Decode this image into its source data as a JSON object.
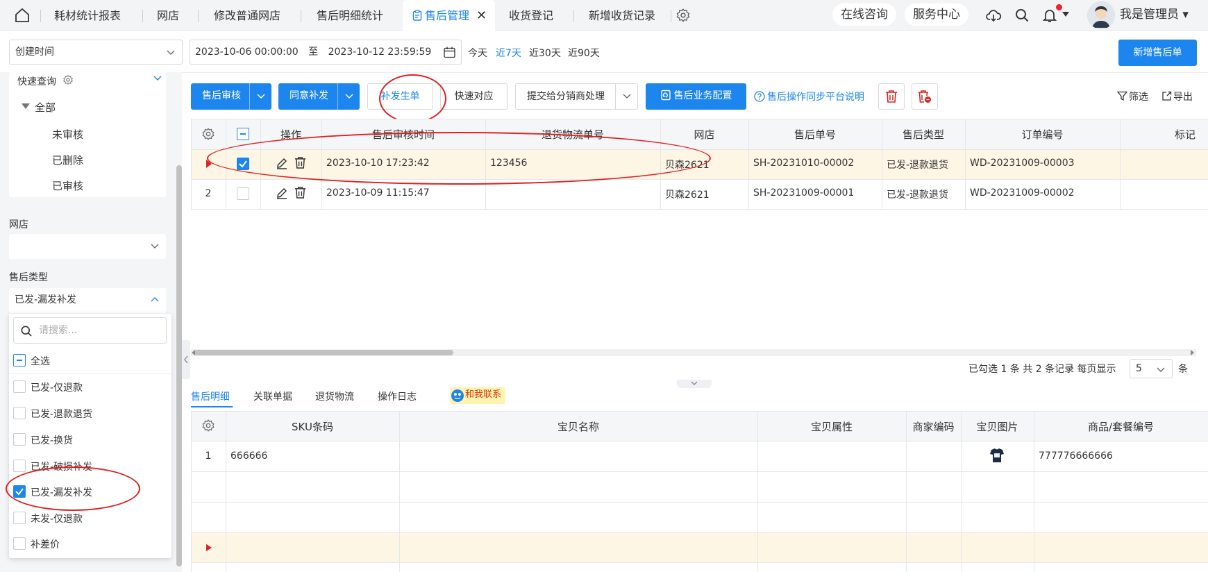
{
  "tabs": [
    "耗材统计报表",
    "网店",
    "修改普通网店",
    "售后明细统计",
    "售后管理",
    "收货登记",
    "新增收货记录"
  ],
  "tab_close": "✕",
  "header": {
    "consult": "在线咨询",
    "service": "服务中心",
    "user": "我是管理员",
    "user_caret": "▾"
  },
  "filter": {
    "date_type": "创建时间",
    "start": "2023-10-06 00:00:00",
    "to": "至",
    "end": "2023-10-12 23:59:59",
    "quick": [
      "今天",
      "近7天",
      "近30天",
      "近90天"
    ],
    "new_button": "新增售后单"
  },
  "sidebar": {
    "quick_query": "快速查询",
    "tree_all": "全部",
    "tree_items": [
      "未审核",
      "已删除",
      "已审核"
    ],
    "shop_label": "网店",
    "type_label": "售后类型",
    "type_value": "已发-漏发补发",
    "search_placeholder": "请搜索...",
    "select_all": "全选",
    "options": [
      "已发-仅退款",
      "已发-退款退货",
      "已发-换货",
      "已发-破损补发",
      "已发-漏发补发",
      "未发-仅退款",
      "补差价"
    ]
  },
  "toolbar": {
    "audit": "售后审核",
    "agree": "同意补发",
    "reissue": "补发生单",
    "quick_match": "快速对应",
    "submit": "提交给分销商处理",
    "config": "售后业务配置",
    "help": "售后操作同步平台说明",
    "filter": "筛选",
    "export": "导出"
  },
  "table": {
    "headers": [
      "操作",
      "售后审核时间",
      "退货物流单号",
      "网店",
      "售后单号",
      "售后类型",
      "订单编号",
      "标记"
    ],
    "rows": [
      {
        "idx": "",
        "time": "2023-10-10 17:23:42",
        "logistics": "123456",
        "shop": "贝森2621",
        "no": "SH-20231010-00002",
        "type": "已发-退款退货",
        "order": "WD-20231009-00003"
      },
      {
        "idx": "2",
        "time": "2023-10-09 11:15:47",
        "logistics": "",
        "shop": "贝森2621",
        "no": "SH-20231009-00001",
        "type": "已发-退款退货",
        "order": "WD-20231009-00002"
      }
    ]
  },
  "pagination": {
    "summary": "已勾选 1 条  共 2 条记录  每页显示",
    "size": "5",
    "unit": "条"
  },
  "detail": {
    "tabs": [
      "售后明细",
      "关联单据",
      "退货物流",
      "操作日志"
    ],
    "contact": "和我联系",
    "headers": [
      "SKU条码",
      "宝贝名称",
      "宝贝属性",
      "商家编码",
      "宝贝图片",
      "商品/套餐编号"
    ],
    "row": {
      "idx": "1",
      "sku": "666666",
      "code": "777776666666"
    }
  }
}
